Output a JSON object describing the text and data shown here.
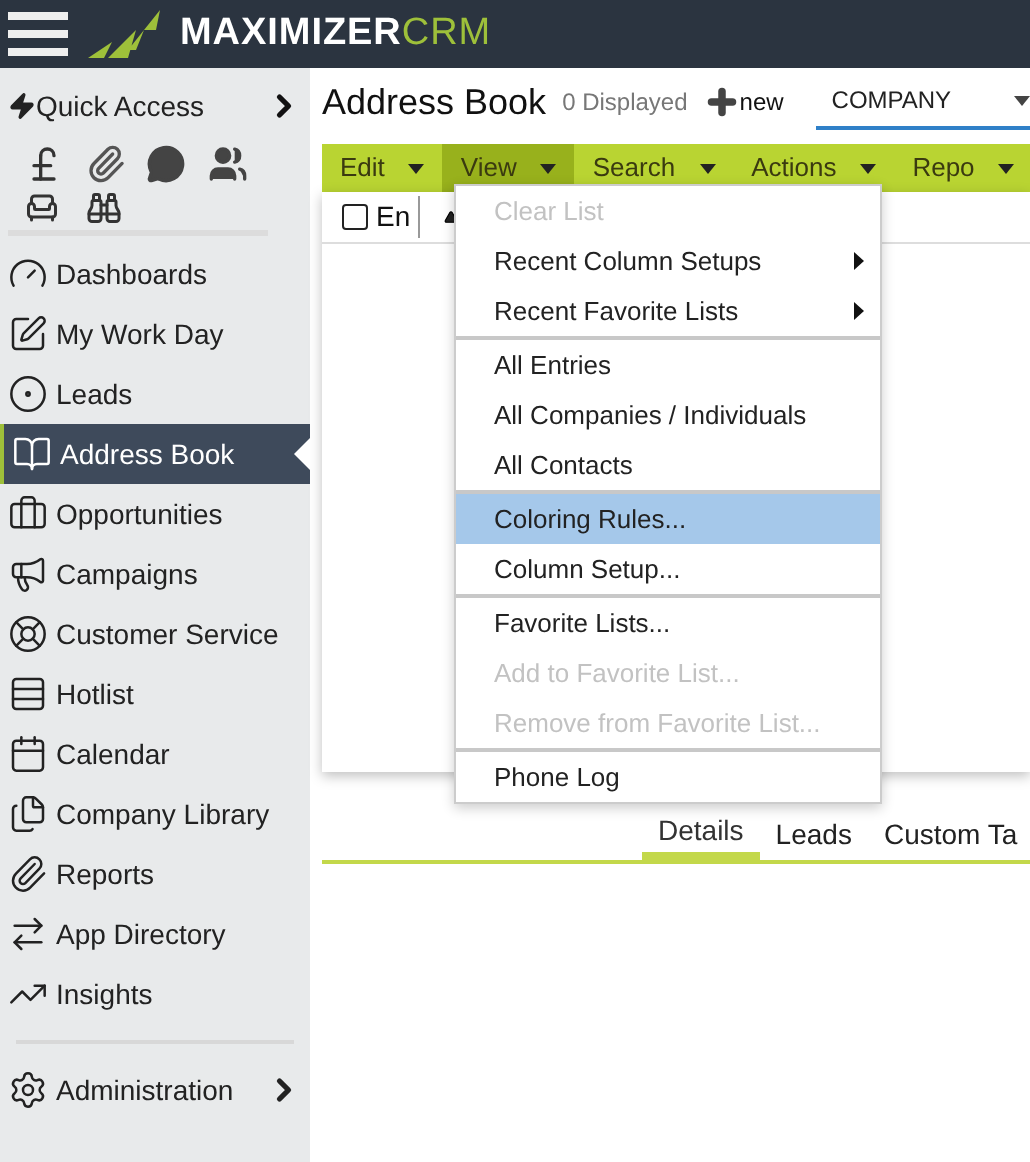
{
  "header": {
    "logo_word": "MAXIMIZER",
    "logo_suffix": "CRM"
  },
  "sidebar": {
    "quick_access": "Quick Access",
    "items": [
      {
        "label": "Dashboards",
        "selected": false
      },
      {
        "label": "My Work Day",
        "selected": false
      },
      {
        "label": "Leads",
        "selected": false
      },
      {
        "label": "Address Book",
        "selected": true
      },
      {
        "label": "Opportunities",
        "selected": false
      },
      {
        "label": "Campaigns",
        "selected": false
      },
      {
        "label": "Customer Service",
        "selected": false
      },
      {
        "label": "Hotlist",
        "selected": false
      },
      {
        "label": "Calendar",
        "selected": false
      },
      {
        "label": "Company Library",
        "selected": false
      },
      {
        "label": "Reports",
        "selected": false
      },
      {
        "label": "App Directory",
        "selected": false
      },
      {
        "label": "Insights",
        "selected": false
      }
    ],
    "administration": "Administration"
  },
  "page": {
    "title": "Address Book",
    "count": "0 Displayed",
    "new_button": "new",
    "search_type": "COMPANY"
  },
  "toolbar": [
    {
      "label": "Edit",
      "selected": false
    },
    {
      "label": "View",
      "selected": true
    },
    {
      "label": "Search",
      "selected": false
    },
    {
      "label": "Actions",
      "selected": false
    },
    {
      "label": "Repo",
      "selected": false
    }
  ],
  "grid": {
    "column_1": "En",
    "select_all_checked": false
  },
  "view_menu": [
    [
      {
        "label": "Clear List",
        "kind": "item",
        "disabled": true,
        "selected": false
      },
      {
        "label": "Recent Column Setups",
        "kind": "submenu",
        "disabled": false,
        "selected": false
      },
      {
        "label": "Recent Favorite Lists",
        "kind": "submenu",
        "disabled": false,
        "selected": false
      }
    ],
    [
      {
        "label": "All Entries",
        "kind": "item",
        "disabled": false,
        "selected": false
      },
      {
        "label": "All Companies / Individuals",
        "kind": "item",
        "disabled": false,
        "selected": false
      },
      {
        "label": "All Contacts",
        "kind": "item",
        "disabled": false,
        "selected": false
      }
    ],
    [
      {
        "label": "Coloring Rules...",
        "kind": "item",
        "disabled": false,
        "selected": true
      },
      {
        "label": "Column Setup...",
        "kind": "item",
        "disabled": false,
        "selected": false
      }
    ],
    [
      {
        "label": "Favorite Lists...",
        "kind": "item",
        "disabled": false,
        "selected": false
      },
      {
        "label": "Add to Favorite List...",
        "kind": "item",
        "disabled": true,
        "selected": false
      },
      {
        "label": "Remove from Favorite List...",
        "kind": "item",
        "disabled": true,
        "selected": false
      }
    ],
    [
      {
        "label": "Phone Log",
        "kind": "item",
        "disabled": false,
        "selected": false
      }
    ]
  ],
  "detail_tabs": [
    {
      "label": "Details",
      "selected": true
    },
    {
      "label": "Leads",
      "selected": false
    },
    {
      "label": "Custom Ta",
      "selected": false
    }
  ]
}
